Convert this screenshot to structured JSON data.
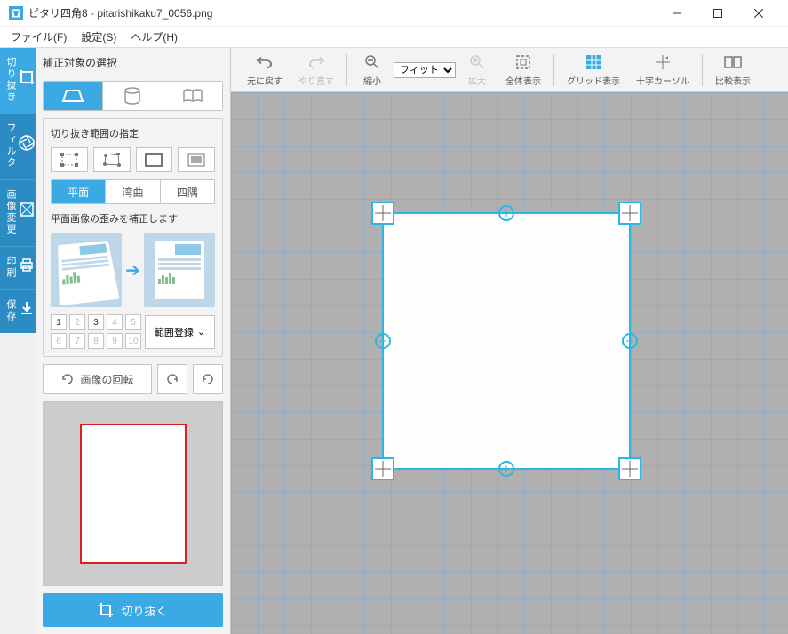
{
  "window": {
    "title": "ピタリ四角8 - pitarishikaku7_0056.png"
  },
  "menu": {
    "file": "ファイル(F)",
    "settings": "設定(S)",
    "help": "ヘルプ(H)"
  },
  "sidetabs": {
    "crop": "切り抜き",
    "filter": "フィルタ",
    "transform": "画像変更",
    "print": "印刷",
    "save": "保存"
  },
  "panel": {
    "title": "補正対象の選択",
    "range_label": "切り抜き範囲の指定",
    "tabs": {
      "flat": "平面",
      "curved": "湾曲",
      "corners": "四隅"
    },
    "desc": "平面画像の歪みを補正します",
    "presets": [
      "1",
      "2",
      "3",
      "4",
      "5",
      "6",
      "7",
      "8",
      "9",
      "10"
    ],
    "register": "範囲登録",
    "rotate": "画像の回転",
    "crop_action": "切り抜く"
  },
  "toolbar": {
    "undo": "元に戻す",
    "redo": "やり直す",
    "zoom_out": "縮小",
    "zoom_select": "フィット",
    "zoom_in": "拡大",
    "fit_all": "全体表示",
    "grid": "グリッド表示",
    "crosshair": "十字カーソル",
    "compare": "比較表示"
  }
}
